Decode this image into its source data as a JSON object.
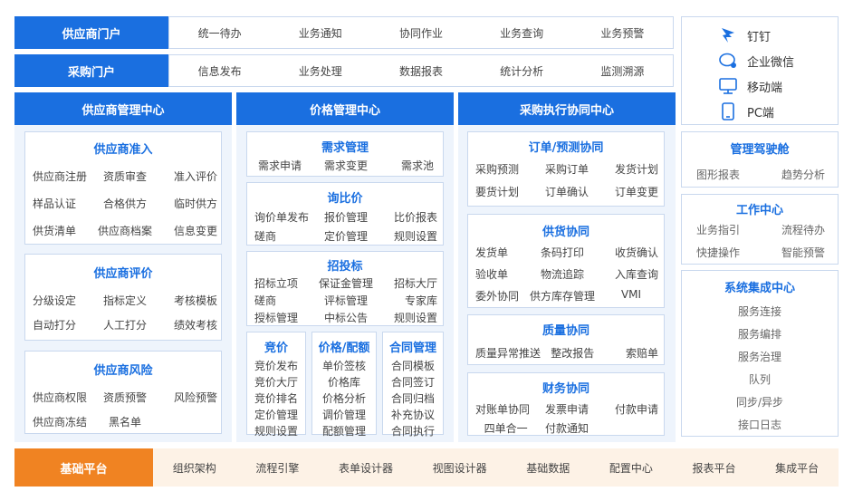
{
  "portals": {
    "supplier": {
      "label": "供应商门户",
      "items": [
        "统一待办",
        "业务通知",
        "协同作业",
        "业务查询",
        "业务预警"
      ]
    },
    "purchase": {
      "label": "采购门户",
      "items": [
        "信息发布",
        "业务处理",
        "数据报表",
        "统计分析",
        "监测溯源"
      ]
    }
  },
  "clients": [
    {
      "label": "钉钉",
      "icon": "dingtalk-icon"
    },
    {
      "label": "企业微信",
      "icon": "wecom-icon"
    },
    {
      "label": "移动端",
      "icon": "monitor-icon"
    },
    {
      "label": "PC端",
      "icon": "tablet-icon"
    }
  ],
  "centers": {
    "supplier_mgmt": "供应商管理中心",
    "price_mgmt": "价格管理中心",
    "purchase_exec": "采购执行协同中心"
  },
  "supplier_cards": {
    "access": {
      "title": "供应商准入",
      "items": [
        "供应商注册",
        "资质审查",
        "准入评价",
        "样品认证",
        "合格供方",
        "临时供方",
        "供货清单",
        "供应商档案",
        "信息变更"
      ]
    },
    "evaluation": {
      "title": "供应商评价",
      "items": [
        "分级设定",
        "指标定义",
        "考核模板",
        "自动打分",
        "人工打分",
        "绩效考核"
      ]
    },
    "risk": {
      "title": "供应商风险",
      "items": [
        "供应商权限",
        "资质预警",
        "风险预警",
        "供应商冻结",
        "黑名单"
      ]
    }
  },
  "price_cards": {
    "demand": {
      "title": "需求管理",
      "items": [
        "需求申请",
        "需求变更",
        "需求池"
      ]
    },
    "inquiry": {
      "title": "询比价",
      "items": [
        "询价单发布",
        "报价管理",
        "比价报表",
        "磋商",
        "定价管理",
        "规则设置"
      ]
    },
    "bidding": {
      "title": "招投标",
      "items": [
        "招标立项",
        "保证金管理",
        "招标大厅",
        "磋商",
        "评标管理",
        "专家库",
        "授标管理",
        "中标公告",
        "规则设置"
      ]
    },
    "auction": {
      "title": "竞价",
      "items": [
        "竞价发布",
        "竞价大厅",
        "竞价排名",
        "定价管理",
        "规则设置"
      ]
    },
    "quota": {
      "title": "价格/配额",
      "items": [
        "单价签核",
        "价格库",
        "价格分析",
        "调价管理",
        "配额管理"
      ]
    },
    "contract": {
      "title": "合同管理",
      "items": [
        "合同模板",
        "合同签订",
        "合同归档",
        "补充协议",
        "合同执行"
      ]
    }
  },
  "exec_cards": {
    "order": {
      "title": "订单/预测协同",
      "items": [
        "采购预测",
        "采购订单",
        "发货计划",
        "要货计划",
        "订单确认",
        "订单变更"
      ]
    },
    "supply": {
      "title": "供货协同",
      "items": [
        "发货单",
        "条码打印",
        "收货确认",
        "验收单",
        "物流追踪",
        "入库查询",
        "委外协同",
        "供方库存管理",
        "VMI"
      ]
    },
    "quality": {
      "title": "质量协同",
      "items": [
        "质量异常推送",
        "整改报告",
        "索赔单"
      ]
    },
    "finance": {
      "title": "财务协同",
      "items": [
        "对账单协同",
        "发票申请",
        "付款申请",
        "四单合一",
        "付款通知"
      ]
    }
  },
  "right_cards": {
    "cockpit": {
      "title": "管理驾驶舱",
      "items": [
        "图形报表",
        "趋势分析"
      ]
    },
    "workcenter": {
      "title": "工作中心",
      "items": [
        "业务指引",
        "流程待办",
        "快捷操作",
        "智能预警"
      ]
    },
    "integration": {
      "title": "系统集成中心",
      "items": [
        "服务连接",
        "服务编排",
        "服务治理",
        "队列",
        "同步/异步",
        "接口日志"
      ]
    }
  },
  "base": {
    "label": "基础平台",
    "items": [
      "组织架构",
      "流程引擎",
      "表单设计器",
      "视图设计器",
      "基础数据",
      "配置中心",
      "报表平台",
      "集成平台"
    ]
  },
  "colors": {
    "primary": "#1a6fe0",
    "accent": "#f08322",
    "panel_bg": "#eef4fc"
  }
}
